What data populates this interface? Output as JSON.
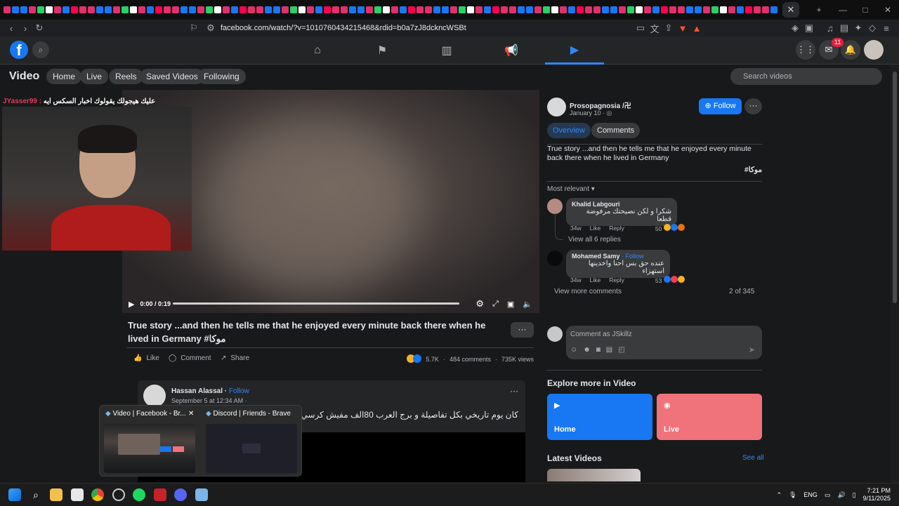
{
  "browser": {
    "url": "facebook.com/watch/?v=1010760434215468&rdid=b0a7zJ8dckncWSBt",
    "tab_close": "✕",
    "new_tab": "+",
    "window_controls": [
      "—",
      "□",
      "✕"
    ],
    "extension_badge": "1"
  },
  "header": {
    "logo": "f",
    "messenger_badge": "11",
    "nav_icons": [
      "home-icon",
      "flag-icon",
      "marketplace-icon",
      "megaphone-icon",
      "video-icon"
    ]
  },
  "subnav": {
    "title": "Video",
    "pills": [
      "Home",
      "Live",
      "Reels",
      "Saved Videos",
      "Following"
    ],
    "search_placeholder": "Search videos"
  },
  "player": {
    "chat_user": "JYasser99 :",
    "chat_message": "عليك هيجولك يقولوك اخبار السكس ايه",
    "time": "0:00 / 0:19",
    "progress": 0.0
  },
  "video": {
    "caption": "True story ...and then he tells me that he enjoyed every minute back there when he lived in Germany #موكا",
    "more": "···",
    "actions": [
      "Like",
      "Comment",
      "Share"
    ],
    "reactions_count": "5.7K",
    "comments_count": "484 comments",
    "views": "735K views"
  },
  "post": {
    "author": "Hassan Alassal",
    "follow": "Follow",
    "date": "September 5 at 12:34 AM ·",
    "text": "كان يوم تاريخي بكل تفاصيلة و برج العرب 80الف مفيش كرسي فاضي اليوم ده متتنسيش ابدا 🇪🇬❤️❤️❤️",
    "more": "···"
  },
  "taskbar_preview": {
    "items": [
      "Video | Facebook - Br...",
      "Discord | Friends - Brave"
    ],
    "close": "✕"
  },
  "right_panel": {
    "author": "Prosopagnosia /卍",
    "date": "January 10 ·",
    "follow_label": "Follow",
    "more": "···",
    "tabs": [
      "Overview",
      "Comments"
    ],
    "description": "True story ...and then he tells me that he enjoyed every minute back there when he lived in Germany",
    "hashtag": "#موكا",
    "sort_label": "Most relevant ▾",
    "comments": [
      {
        "author": "Khalid Labgouri",
        "text": "شكرا و لكن نصيحتك مرفوضة قطعا",
        "time": "34w",
        "like": "Like",
        "reply": "Reply",
        "reactions": "50"
      },
      {
        "author": "Mohamed Samy",
        "follow": "· Follow",
        "text": "عنده حق بس احنا واخدينها استهزاء",
        "time": "34w",
        "like": "Like",
        "reply": "Reply",
        "reactions": "53"
      }
    ],
    "view_replies": "View all 6 replies",
    "view_more": "View more comments",
    "count": "2 of 345",
    "comment_placeholder": "Comment as JSkillz",
    "explore_title": "Explore more in Video",
    "cards": [
      "Home",
      "Live"
    ],
    "latest_title": "Latest Videos",
    "see_all": "See all"
  },
  "system_tray": {
    "language": "ENG",
    "time": "7:21 PM",
    "date": "9/11/2025"
  },
  "colors": {
    "accent": "#1877f2",
    "live_card": "#f0727b",
    "background": "#18191a"
  }
}
